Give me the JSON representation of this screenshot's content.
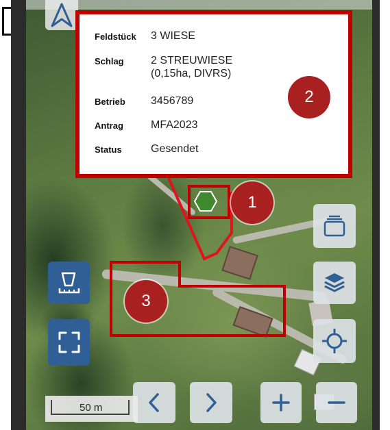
{
  "info": {
    "rows": [
      {
        "label": "Feldstück",
        "value": "3 WIESE"
      },
      {
        "label": "Schlag",
        "value": "2 STREUWIESE",
        "value2": "(0,15ha, DIVRS)"
      },
      {
        "label": "Betrieb",
        "value": "3456789"
      },
      {
        "label": "Antrag",
        "value": "MFA2023"
      },
      {
        "label": "Status",
        "value": "Gesendet"
      }
    ]
  },
  "badges": {
    "one": "1",
    "two": "2",
    "three": "3"
  },
  "scale": {
    "label": "50 m"
  },
  "icons": {
    "north": "north-arrow-icon",
    "measure": "measure-area-icon",
    "fullscreen": "fullscreen-icon",
    "cards": "card-stack-icon",
    "layers": "layers-icon",
    "locate": "locate-crosshair-icon",
    "prev": "chevron-left-icon",
    "next": "chevron-right-icon",
    "zoom_in": "plus-icon",
    "zoom_out": "minus-icon",
    "marker": "hexagon-marker-icon"
  },
  "colors": {
    "highlight": "#c00000",
    "badge": "#a8201f",
    "marker": "#3f8a2e",
    "dark_button": "#2f5f94",
    "light_button": "#dce2e6"
  }
}
